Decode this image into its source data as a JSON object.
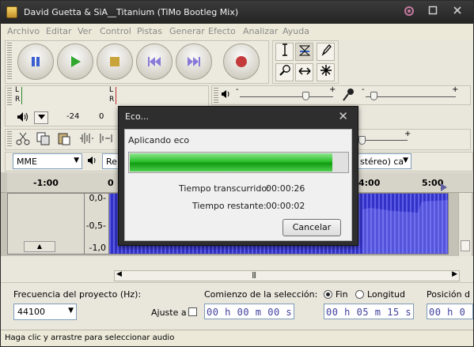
{
  "window": {
    "title": "David Guetta & SiA__Titanium (TiMo Bootleg Mix)"
  },
  "menu": [
    "Archivo",
    "Editar",
    "Ver",
    "Control",
    "Pistas",
    "Generar",
    "Efecto",
    "Analizar",
    "Ayuda"
  ],
  "meters": {
    "l": "L",
    "r": "R",
    "l2": "L",
    "r2": "R",
    "db_a": "-24",
    "db_b": "0"
  },
  "mixer": {
    "minus": "-",
    "plus": "+"
  },
  "device": {
    "host": "MME",
    "rec_partial": "Re",
    "channels_partial": "stéreo) ca"
  },
  "ruler": {
    "ticks": [
      "-1:00",
      "0",
      "4:00",
      "5:00"
    ]
  },
  "track": {
    "axis": [
      "0,0-",
      "-0,5-",
      "-1,0"
    ],
    "collapse_glyph": "▲"
  },
  "hscroll_glyph": "|||",
  "bottom": {
    "rate_label": "Frecuencia del proyecto (Hz):",
    "rate_value": "44100",
    "snap_label": "Ajuste a",
    "selection_label": "Comienzo de la selección:",
    "end_label": "Fin",
    "length_label": "Longitud",
    "position_label": "Posición d",
    "start_time": "00 h 00 m 00 s",
    "end_time": "00 h 05 m 15 s",
    "pos_time": "00 h 0"
  },
  "status": "Haga clic y arrastre para seleccionar audio",
  "dialog": {
    "title": "Eco...",
    "applying": "Aplicando eco",
    "elapsed_label": "Tiempo transcurrido:",
    "elapsed_value": "00:00:26",
    "remaining_label": "Tiempo restante:",
    "remaining_value": "00:00:02",
    "cancel_label": "Cancelar",
    "progress_fraction": 0.93
  },
  "colors": {
    "wave": "#3232c8",
    "progress": "#2bbf2b",
    "titlebar": "#2e2e2e"
  },
  "icons": [
    "app-icon",
    "minimize-icon",
    "maximize-icon",
    "close-icon",
    "pause-icon",
    "play-icon",
    "stop-icon",
    "skip-start-icon",
    "skip-end-icon",
    "record-icon",
    "selection-tool-icon",
    "envelope-tool-icon",
    "draw-tool-icon",
    "zoom-tool-icon",
    "timeshift-tool-icon",
    "multi-tool-icon",
    "speaker-icon",
    "microphone-icon"
  ]
}
